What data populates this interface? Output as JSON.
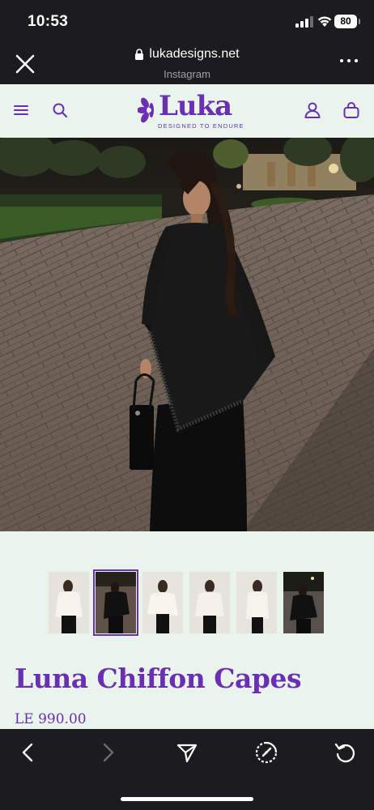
{
  "status_bar": {
    "time": "10:53",
    "battery": "80"
  },
  "browser": {
    "url": "lukadesigns.net",
    "source": "Instagram",
    "close_icon": "close-icon",
    "more_icon": "more-icon"
  },
  "site": {
    "logo_text": "Luka",
    "tagline": "DESIGNED TO ENDURE",
    "brand_color": "#6b2fb3",
    "background_color": "#e9f5ec",
    "icons": [
      "menu-icon",
      "search-icon",
      "account-icon",
      "cart-icon"
    ]
  },
  "product": {
    "title": "Luna Chiffon Capes",
    "price": "LE 990.00",
    "thumbnails": [
      {
        "name": "thumb-white-cape-1",
        "variant": "white"
      },
      {
        "name": "thumb-black-cape-night",
        "variant": "black",
        "selected": true
      },
      {
        "name": "thumb-white-cape-2",
        "variant": "white"
      },
      {
        "name": "thumb-white-cape-3",
        "variant": "white"
      },
      {
        "name": "thumb-white-cape-4",
        "variant": "white"
      },
      {
        "name": "thumb-black-cape-night-2",
        "variant": "black"
      }
    ]
  },
  "toolbar": {
    "icons": [
      "back-icon",
      "forward-icon",
      "share-icon",
      "compass-icon",
      "reload-icon"
    ]
  }
}
